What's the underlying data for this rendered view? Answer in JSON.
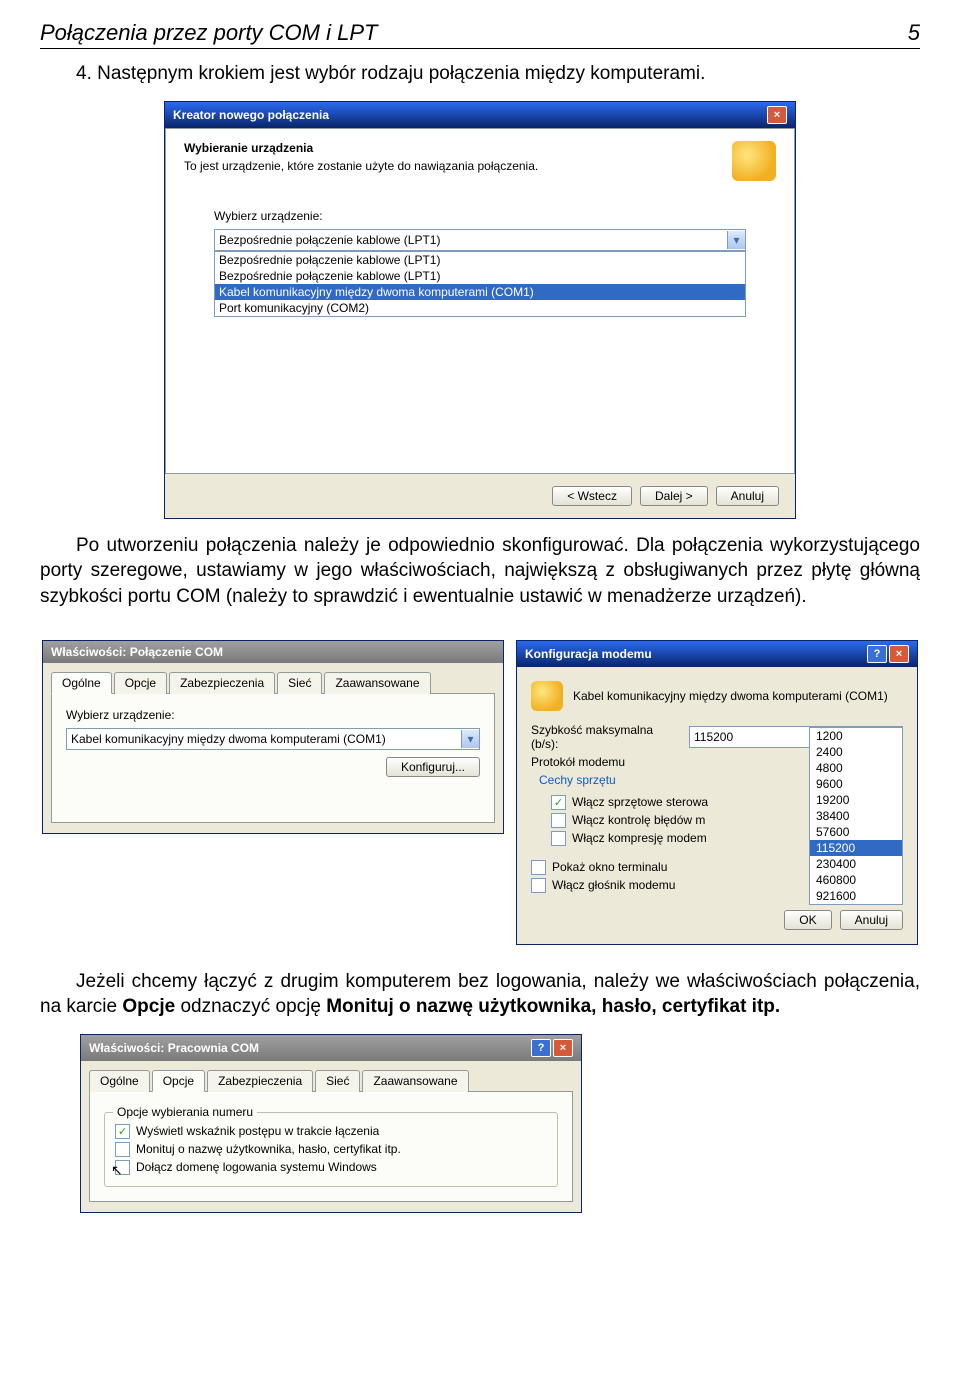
{
  "header": {
    "title": "Połączenia przez porty COM i LPT",
    "page": "5"
  },
  "para1": "4. Następnym krokiem jest wybór rodzaju połączenia między komputerami.",
  "wizard": {
    "title": "Kreator nowego połączenia",
    "heading": "Wybieranie urządzenia",
    "sub": "To jest urządzenie, które zostanie użyte do nawiązania połączenia.",
    "select_label": "Wybierz urządzenie:",
    "selected": "Bezpośrednie połączenie kablowe (LPT1)",
    "items": [
      "Bezpośrednie połączenie kablowe (LPT1)",
      "Bezpośrednie połączenie kablowe (LPT1)",
      "Kabel komunikacyjny między dwoma komputerami (COM1)",
      "Port komunikacyjny (COM2)"
    ],
    "buttons": {
      "back": "< Wstecz",
      "next": "Dalej >",
      "cancel": "Anuluj"
    }
  },
  "para2": "Po utworzeniu połączenia należy je odpowiednio skonfigurować. Dla połączenia wykorzystującego porty szeregowe, ustawiamy w jego właściwościach, największą z obsługiwanych przez płytę główną szybkości portu COM (należy to sprawdzić i ewentualnie ustawić w menadżerze urządzeń).",
  "props": {
    "title": "Właściwości: Połączenie COM",
    "tabs": [
      "Ogólne",
      "Opcje",
      "Zabezpieczenia",
      "Sieć",
      "Zaawansowane"
    ],
    "select_label": "Wybierz urządzenie:",
    "device": "Kabel komunikacyjny między dwoma komputerami (COM1)",
    "configure": "Konfiguruj..."
  },
  "modem": {
    "title": "Konfiguracja modemu",
    "device_line": "Kabel komunikacyjny między dwoma komputerami (COM1)",
    "speed_label": "Szybkość maksymalna (b/s):",
    "speed_value": "115200",
    "protocol_label": "Protokół modemu",
    "options": [
      "1200",
      "2400",
      "4800",
      "9600",
      "19200",
      "38400",
      "57600",
      "115200",
      "230400",
      "460800",
      "921600"
    ],
    "features_label": "Cechy sprzętu",
    "chk1": "Włącz sprzętowe sterowa",
    "chk2": "Włącz kontrolę błędów m",
    "chk3": "Włącz kompresję modem",
    "chk_terminal": "Pokaż okno terminalu",
    "chk_speaker": "Włącz głośnik modemu",
    "ok": "OK",
    "cancel": "Anuluj"
  },
  "para3": "Jeżeli chcemy łączyć z drugim komputerem bez logowania, należy we właściwościach połączenia, na karcie Opcje odznaczyć opcję Monituj o nazwę użytkownika, hasło, certyfikat itp.",
  "bold_card": "Opcje",
  "bold_opt": "Monituj o nazwę użytkownika, hasło, certyfikat itp.",
  "props2": {
    "title": "Właściwości: Pracownia COM",
    "tabs": [
      "Ogólne",
      "Opcje",
      "Zabezpieczenia",
      "Sieć",
      "Zaawansowane"
    ],
    "group": "Opcje wybierania numeru",
    "chk1": "Wyświetl wskaźnik postępu w trakcie łączenia",
    "chk2": "Monituj o nazwę użytkownika, hasło, certyfikat itp.",
    "chk3": "Dołącz domenę logowania systemu Windows"
  }
}
